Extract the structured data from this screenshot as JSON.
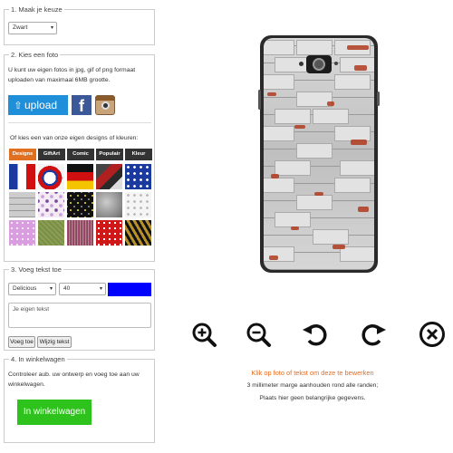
{
  "step1": {
    "legend": "1. Maak je keuze",
    "color_select": "Zwart"
  },
  "step2": {
    "legend": "2. Kies een foto",
    "intro": "U kunt uw eigen fotos in jpg, gif of png formaat uploaden van maximaal 6MB grootte.",
    "upload_label": "upload",
    "facebook_letter": "f",
    "designs_intro": "Of kies een van onze eigen designs of kleuren:",
    "tabs": [
      "Designs",
      "GiftArt",
      "Comic",
      "Populair",
      "Kleur"
    ]
  },
  "step3": {
    "legend": "3. Voeg tekst toe",
    "font_select": "Delicious",
    "size_select": "40",
    "text_color": "#0000ff",
    "placeholder": "Je eigen tekst",
    "add_label": "Voeg toe",
    "change_label": "Wijzig tekst"
  },
  "step4": {
    "legend": "4. In winkelwagen",
    "intro": "Controleer aub. uw ontwerp en voeg toe aan uw winkelwagen.",
    "cart_label": "In winkelwagen"
  },
  "preview": {
    "hint": "Klik op foto of tekst om deze te bewerken",
    "margin_note": "3 millimeter marge aanhouden rond alle randen;",
    "important_note": "Plaats hier geen belangrijke gegevens."
  },
  "toolbar": {
    "icons": [
      "zoom-in-icon",
      "zoom-out-icon",
      "rotate-left-icon",
      "rotate-right-icon",
      "delete-icon"
    ]
  },
  "colors": {
    "accent_orange": "#e07020",
    "upload_blue": "#1e8fd8",
    "cart_green": "#2ec21c",
    "hint_orange": "#e86a1a"
  }
}
